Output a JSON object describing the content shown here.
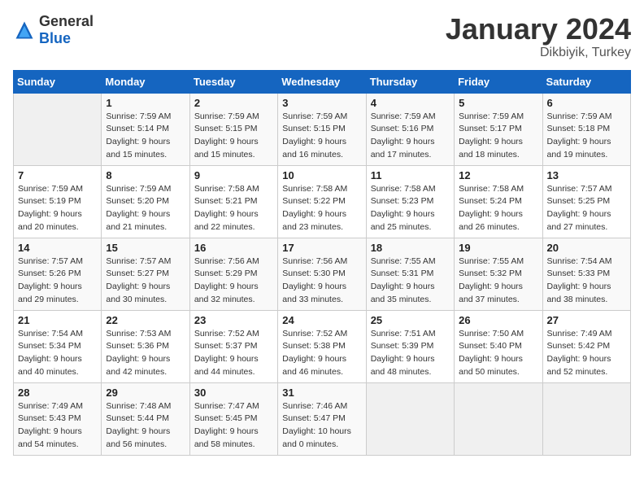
{
  "header": {
    "logo_general": "General",
    "logo_blue": "Blue",
    "title": "January 2024",
    "subtitle": "Dikbiyik, Turkey"
  },
  "columns": [
    "Sunday",
    "Monday",
    "Tuesday",
    "Wednesday",
    "Thursday",
    "Friday",
    "Saturday"
  ],
  "weeks": [
    [
      {
        "day": "",
        "empty": true
      },
      {
        "day": "1",
        "sunrise": "Sunrise: 7:59 AM",
        "sunset": "Sunset: 5:14 PM",
        "daylight": "Daylight: 9 hours and 15 minutes."
      },
      {
        "day": "2",
        "sunrise": "Sunrise: 7:59 AM",
        "sunset": "Sunset: 5:15 PM",
        "daylight": "Daylight: 9 hours and 15 minutes."
      },
      {
        "day": "3",
        "sunrise": "Sunrise: 7:59 AM",
        "sunset": "Sunset: 5:15 PM",
        "daylight": "Daylight: 9 hours and 16 minutes."
      },
      {
        "day": "4",
        "sunrise": "Sunrise: 7:59 AM",
        "sunset": "Sunset: 5:16 PM",
        "daylight": "Daylight: 9 hours and 17 minutes."
      },
      {
        "day": "5",
        "sunrise": "Sunrise: 7:59 AM",
        "sunset": "Sunset: 5:17 PM",
        "daylight": "Daylight: 9 hours and 18 minutes."
      },
      {
        "day": "6",
        "sunrise": "Sunrise: 7:59 AM",
        "sunset": "Sunset: 5:18 PM",
        "daylight": "Daylight: 9 hours and 19 minutes."
      }
    ],
    [
      {
        "day": "7",
        "sunrise": "Sunrise: 7:59 AM",
        "sunset": "Sunset: 5:19 PM",
        "daylight": "Daylight: 9 hours and 20 minutes."
      },
      {
        "day": "8",
        "sunrise": "Sunrise: 7:59 AM",
        "sunset": "Sunset: 5:20 PM",
        "daylight": "Daylight: 9 hours and 21 minutes."
      },
      {
        "day": "9",
        "sunrise": "Sunrise: 7:58 AM",
        "sunset": "Sunset: 5:21 PM",
        "daylight": "Daylight: 9 hours and 22 minutes."
      },
      {
        "day": "10",
        "sunrise": "Sunrise: 7:58 AM",
        "sunset": "Sunset: 5:22 PM",
        "daylight": "Daylight: 9 hours and 23 minutes."
      },
      {
        "day": "11",
        "sunrise": "Sunrise: 7:58 AM",
        "sunset": "Sunset: 5:23 PM",
        "daylight": "Daylight: 9 hours and 25 minutes."
      },
      {
        "day": "12",
        "sunrise": "Sunrise: 7:58 AM",
        "sunset": "Sunset: 5:24 PM",
        "daylight": "Daylight: 9 hours and 26 minutes."
      },
      {
        "day": "13",
        "sunrise": "Sunrise: 7:57 AM",
        "sunset": "Sunset: 5:25 PM",
        "daylight": "Daylight: 9 hours and 27 minutes."
      }
    ],
    [
      {
        "day": "14",
        "sunrise": "Sunrise: 7:57 AM",
        "sunset": "Sunset: 5:26 PM",
        "daylight": "Daylight: 9 hours and 29 minutes."
      },
      {
        "day": "15",
        "sunrise": "Sunrise: 7:57 AM",
        "sunset": "Sunset: 5:27 PM",
        "daylight": "Daylight: 9 hours and 30 minutes."
      },
      {
        "day": "16",
        "sunrise": "Sunrise: 7:56 AM",
        "sunset": "Sunset: 5:29 PM",
        "daylight": "Daylight: 9 hours and 32 minutes."
      },
      {
        "day": "17",
        "sunrise": "Sunrise: 7:56 AM",
        "sunset": "Sunset: 5:30 PM",
        "daylight": "Daylight: 9 hours and 33 minutes."
      },
      {
        "day": "18",
        "sunrise": "Sunrise: 7:55 AM",
        "sunset": "Sunset: 5:31 PM",
        "daylight": "Daylight: 9 hours and 35 minutes."
      },
      {
        "day": "19",
        "sunrise": "Sunrise: 7:55 AM",
        "sunset": "Sunset: 5:32 PM",
        "daylight": "Daylight: 9 hours and 37 minutes."
      },
      {
        "day": "20",
        "sunrise": "Sunrise: 7:54 AM",
        "sunset": "Sunset: 5:33 PM",
        "daylight": "Daylight: 9 hours and 38 minutes."
      }
    ],
    [
      {
        "day": "21",
        "sunrise": "Sunrise: 7:54 AM",
        "sunset": "Sunset: 5:34 PM",
        "daylight": "Daylight: 9 hours and 40 minutes."
      },
      {
        "day": "22",
        "sunrise": "Sunrise: 7:53 AM",
        "sunset": "Sunset: 5:36 PM",
        "daylight": "Daylight: 9 hours and 42 minutes."
      },
      {
        "day": "23",
        "sunrise": "Sunrise: 7:52 AM",
        "sunset": "Sunset: 5:37 PM",
        "daylight": "Daylight: 9 hours and 44 minutes."
      },
      {
        "day": "24",
        "sunrise": "Sunrise: 7:52 AM",
        "sunset": "Sunset: 5:38 PM",
        "daylight": "Daylight: 9 hours and 46 minutes."
      },
      {
        "day": "25",
        "sunrise": "Sunrise: 7:51 AM",
        "sunset": "Sunset: 5:39 PM",
        "daylight": "Daylight: 9 hours and 48 minutes."
      },
      {
        "day": "26",
        "sunrise": "Sunrise: 7:50 AM",
        "sunset": "Sunset: 5:40 PM",
        "daylight": "Daylight: 9 hours and 50 minutes."
      },
      {
        "day": "27",
        "sunrise": "Sunrise: 7:49 AM",
        "sunset": "Sunset: 5:42 PM",
        "daylight": "Daylight: 9 hours and 52 minutes."
      }
    ],
    [
      {
        "day": "28",
        "sunrise": "Sunrise: 7:49 AM",
        "sunset": "Sunset: 5:43 PM",
        "daylight": "Daylight: 9 hours and 54 minutes."
      },
      {
        "day": "29",
        "sunrise": "Sunrise: 7:48 AM",
        "sunset": "Sunset: 5:44 PM",
        "daylight": "Daylight: 9 hours and 56 minutes."
      },
      {
        "day": "30",
        "sunrise": "Sunrise: 7:47 AM",
        "sunset": "Sunset: 5:45 PM",
        "daylight": "Daylight: 9 hours and 58 minutes."
      },
      {
        "day": "31",
        "sunrise": "Sunrise: 7:46 AM",
        "sunset": "Sunset: 5:47 PM",
        "daylight": "Daylight: 10 hours and 0 minutes."
      },
      {
        "day": "",
        "empty": true
      },
      {
        "day": "",
        "empty": true
      },
      {
        "day": "",
        "empty": true
      }
    ]
  ]
}
